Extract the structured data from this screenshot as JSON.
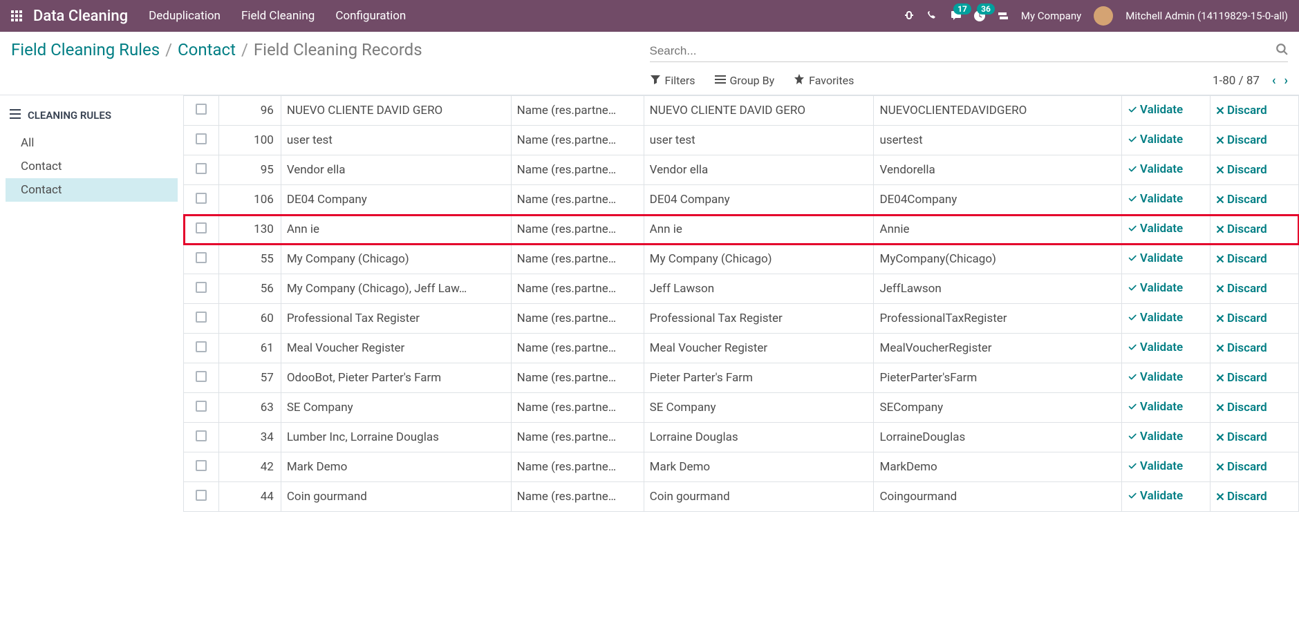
{
  "navbar": {
    "brand": "Data Cleaning",
    "menu": [
      "Deduplication",
      "Field Cleaning",
      "Configuration"
    ],
    "company": "My Company",
    "user": "Mitchell Admin (14119829-15-0-all)",
    "messages_badge": "17",
    "activities_badge": "36"
  },
  "breadcrumb": {
    "root": "Field Cleaning Rules",
    "mid": "Contact",
    "current": "Field Cleaning Records"
  },
  "search": {
    "placeholder": "Search..."
  },
  "filters": {
    "filters_label": "Filters",
    "groupby_label": "Group By",
    "favorites_label": "Favorites"
  },
  "pager": {
    "range": "1-80",
    "sep": "/",
    "total": "87"
  },
  "sidebar": {
    "header": "CLEANING RULES",
    "items": [
      {
        "label": "All",
        "active": false
      },
      {
        "label": "Contact",
        "active": false
      },
      {
        "label": "Contact",
        "active": true
      }
    ]
  },
  "actions": {
    "validate": "Validate",
    "discard": "Discard"
  },
  "field_label": "Name (res.partne…",
  "rows": [
    {
      "id": "96",
      "record": "NUEVO CLIENTE DAVID GERO",
      "current": "NUEVO CLIENTE DAVID GERO",
      "suggested": "NUEVOCLIENTEDAVIDGERO",
      "hl": false
    },
    {
      "id": "100",
      "record": "user test",
      "current": "user test",
      "suggested": "usertest",
      "hl": false
    },
    {
      "id": "95",
      "record": "Vendor ella",
      "current": "Vendor ella",
      "suggested": "Vendorella",
      "hl": false
    },
    {
      "id": "106",
      "record": "DE04 Company",
      "current": "DE04 Company",
      "suggested": "DE04Company",
      "hl": false
    },
    {
      "id": "130",
      "record": "Ann ie",
      "current": "Ann ie",
      "suggested": "Annie",
      "hl": true
    },
    {
      "id": "55",
      "record": "My Company (Chicago)",
      "current": "My Company (Chicago)",
      "suggested": "MyCompany(Chicago)",
      "hl": false
    },
    {
      "id": "56",
      "record": "My Company (Chicago), Jeff Law…",
      "current": "Jeff Lawson",
      "suggested": "JeffLawson",
      "hl": false
    },
    {
      "id": "60",
      "record": "Professional Tax Register",
      "current": "Professional Tax Register",
      "suggested": "ProfessionalTaxRegister",
      "hl": false
    },
    {
      "id": "61",
      "record": "Meal Voucher Register",
      "current": "Meal Voucher Register",
      "suggested": "MealVoucherRegister",
      "hl": false
    },
    {
      "id": "57",
      "record": "OdooBot, Pieter Parter's Farm",
      "current": "Pieter Parter's Farm",
      "suggested": "PieterParter'sFarm",
      "hl": false
    },
    {
      "id": "63",
      "record": "SE Company",
      "current": "SE Company",
      "suggested": "SECompany",
      "hl": false
    },
    {
      "id": "34",
      "record": "Lumber Inc, Lorraine Douglas",
      "current": "Lorraine Douglas",
      "suggested": "LorraineDouglas",
      "hl": false
    },
    {
      "id": "42",
      "record": "Mark Demo",
      "current": "Mark Demo",
      "suggested": "MarkDemo",
      "hl": false
    },
    {
      "id": "44",
      "record": "Coin gourmand",
      "current": "Coin gourmand",
      "suggested": "Coingourmand",
      "hl": false
    }
  ]
}
